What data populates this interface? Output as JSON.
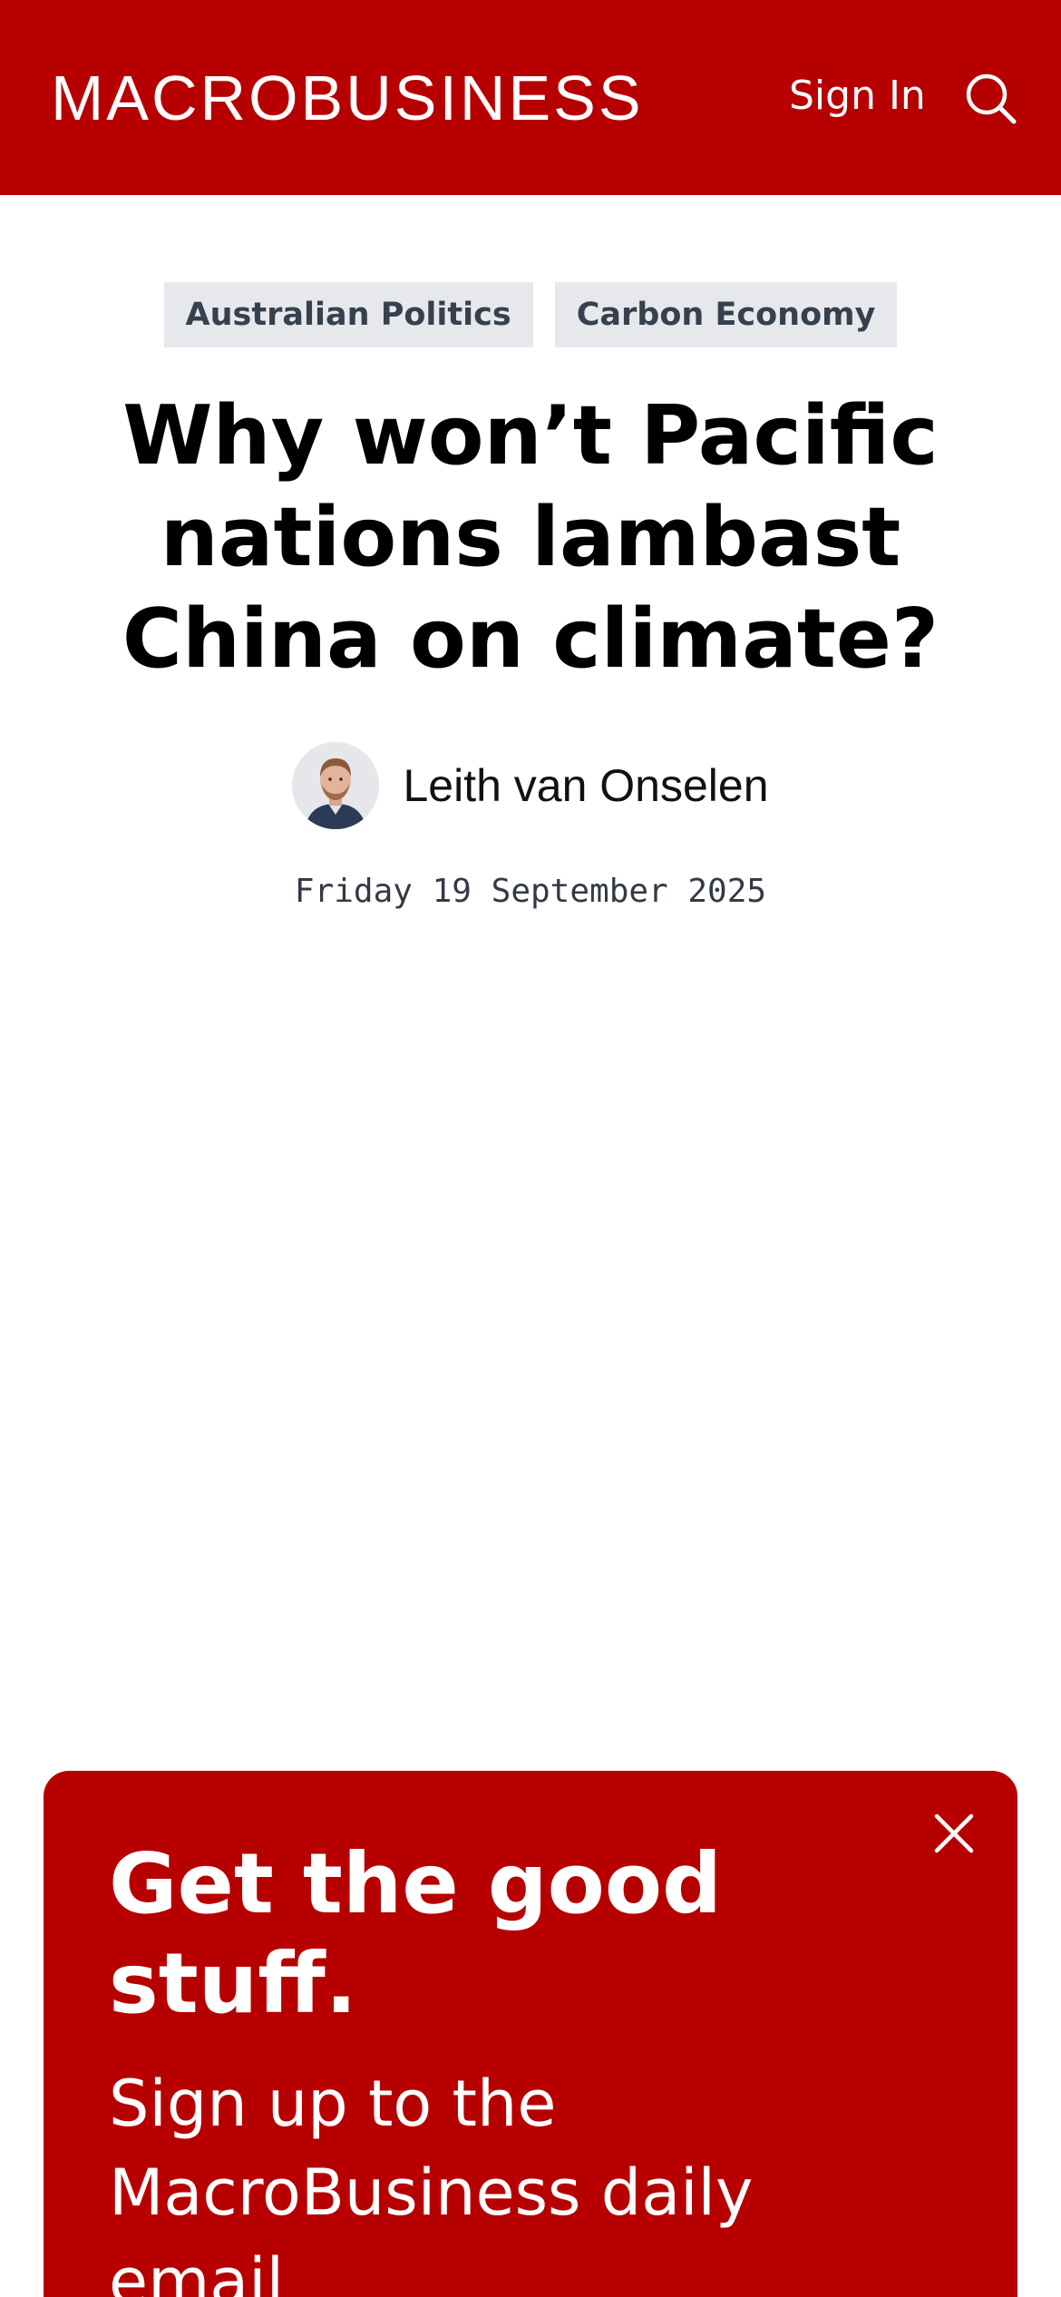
{
  "header": {
    "logo": "MACROBUSINESS",
    "sign_in_label": "Sign In",
    "search_icon": "search-icon",
    "background_color": "#b70000"
  },
  "article": {
    "tags": [
      {
        "label": "Australian Politics"
      },
      {
        "label": "Carbon Economy"
      }
    ],
    "title": "Why won’t Pacific nations lambast China on climate?",
    "author": {
      "name": "Leith van Onselen",
      "avatar_icon": "author-avatar"
    },
    "date": "Friday 19 September 2025"
  },
  "signup_popup": {
    "title": "Get the good stuff.",
    "subtitle": "Sign up to the MacroBusiness daily email",
    "close_icon": "close-icon",
    "background_color": "#b70000"
  }
}
